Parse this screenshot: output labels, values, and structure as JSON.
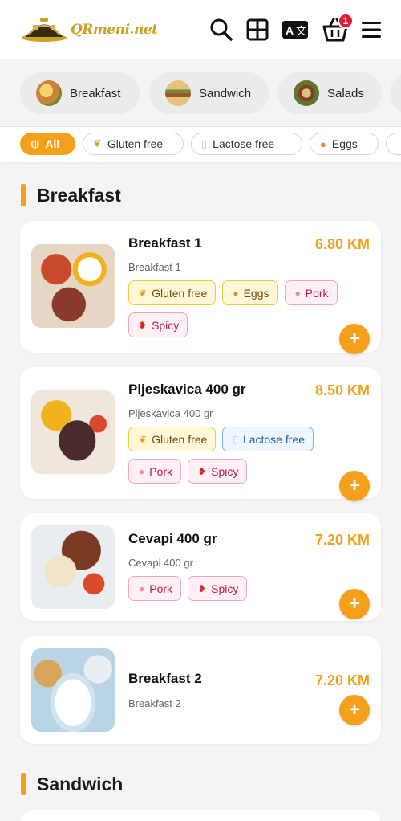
{
  "header": {
    "brand": "QRmeni.net",
    "cart_count": "1",
    "icons": [
      "search-icon",
      "grid-icon",
      "translate-icon",
      "cart-icon",
      "menu-icon"
    ]
  },
  "categories": [
    {
      "label": "Breakfast",
      "color": "#c9843a"
    },
    {
      "label": "Sandwich",
      "color": "#b58a3c"
    },
    {
      "label": "Salads",
      "color": "#a65a3c"
    }
  ],
  "filters": [
    {
      "label": "All",
      "icon": "all-icon",
      "active": true
    },
    {
      "label": "Gluten free",
      "icon": "wheat-icon"
    },
    {
      "label": "Lactose free",
      "icon": "glass-icon"
    },
    {
      "label": "Eggs",
      "icon": "egg-icon"
    }
  ],
  "sections": [
    {
      "title": "Breakfast",
      "items": [
        {
          "name": "Breakfast 1",
          "description": "Breakfast 1",
          "price": "6.80 KM",
          "tags": [
            {
              "label": "Gluten free",
              "icon": "wheat-icon"
            },
            {
              "label": "Eggs",
              "icon": "egg-icon"
            },
            {
              "label": "Pork",
              "icon": "pig-icon"
            },
            {
              "label": "Spicy",
              "icon": "chili-icon"
            }
          ]
        },
        {
          "name": "Pljeskavica 400 gr",
          "description": "Pljeskavica 400 gr",
          "price": "8.50 KM",
          "tags": [
            {
              "label": "Gluten free",
              "icon": "wheat-icon"
            },
            {
              "label": "Lactose free",
              "icon": "glass-icon"
            },
            {
              "label": "Pork",
              "icon": "pig-icon"
            },
            {
              "label": "Spicy",
              "icon": "chili-icon"
            }
          ]
        },
        {
          "name": "Cevapi 400 gr",
          "description": "Cevapi 400 gr",
          "price": "7.20 KM",
          "tags": [
            {
              "label": "Pork",
              "icon": "pig-icon"
            },
            {
              "label": "Spicy",
              "icon": "chili-icon"
            }
          ]
        },
        {
          "name": "Breakfast 2",
          "description": "Breakfast 2",
          "price": "7.20 KM",
          "tags": []
        }
      ]
    },
    {
      "title": "Sandwich",
      "items": []
    }
  ],
  "add_label": "+",
  "colors": {
    "accent": "#f5a01a",
    "badge": "#e8192c"
  }
}
